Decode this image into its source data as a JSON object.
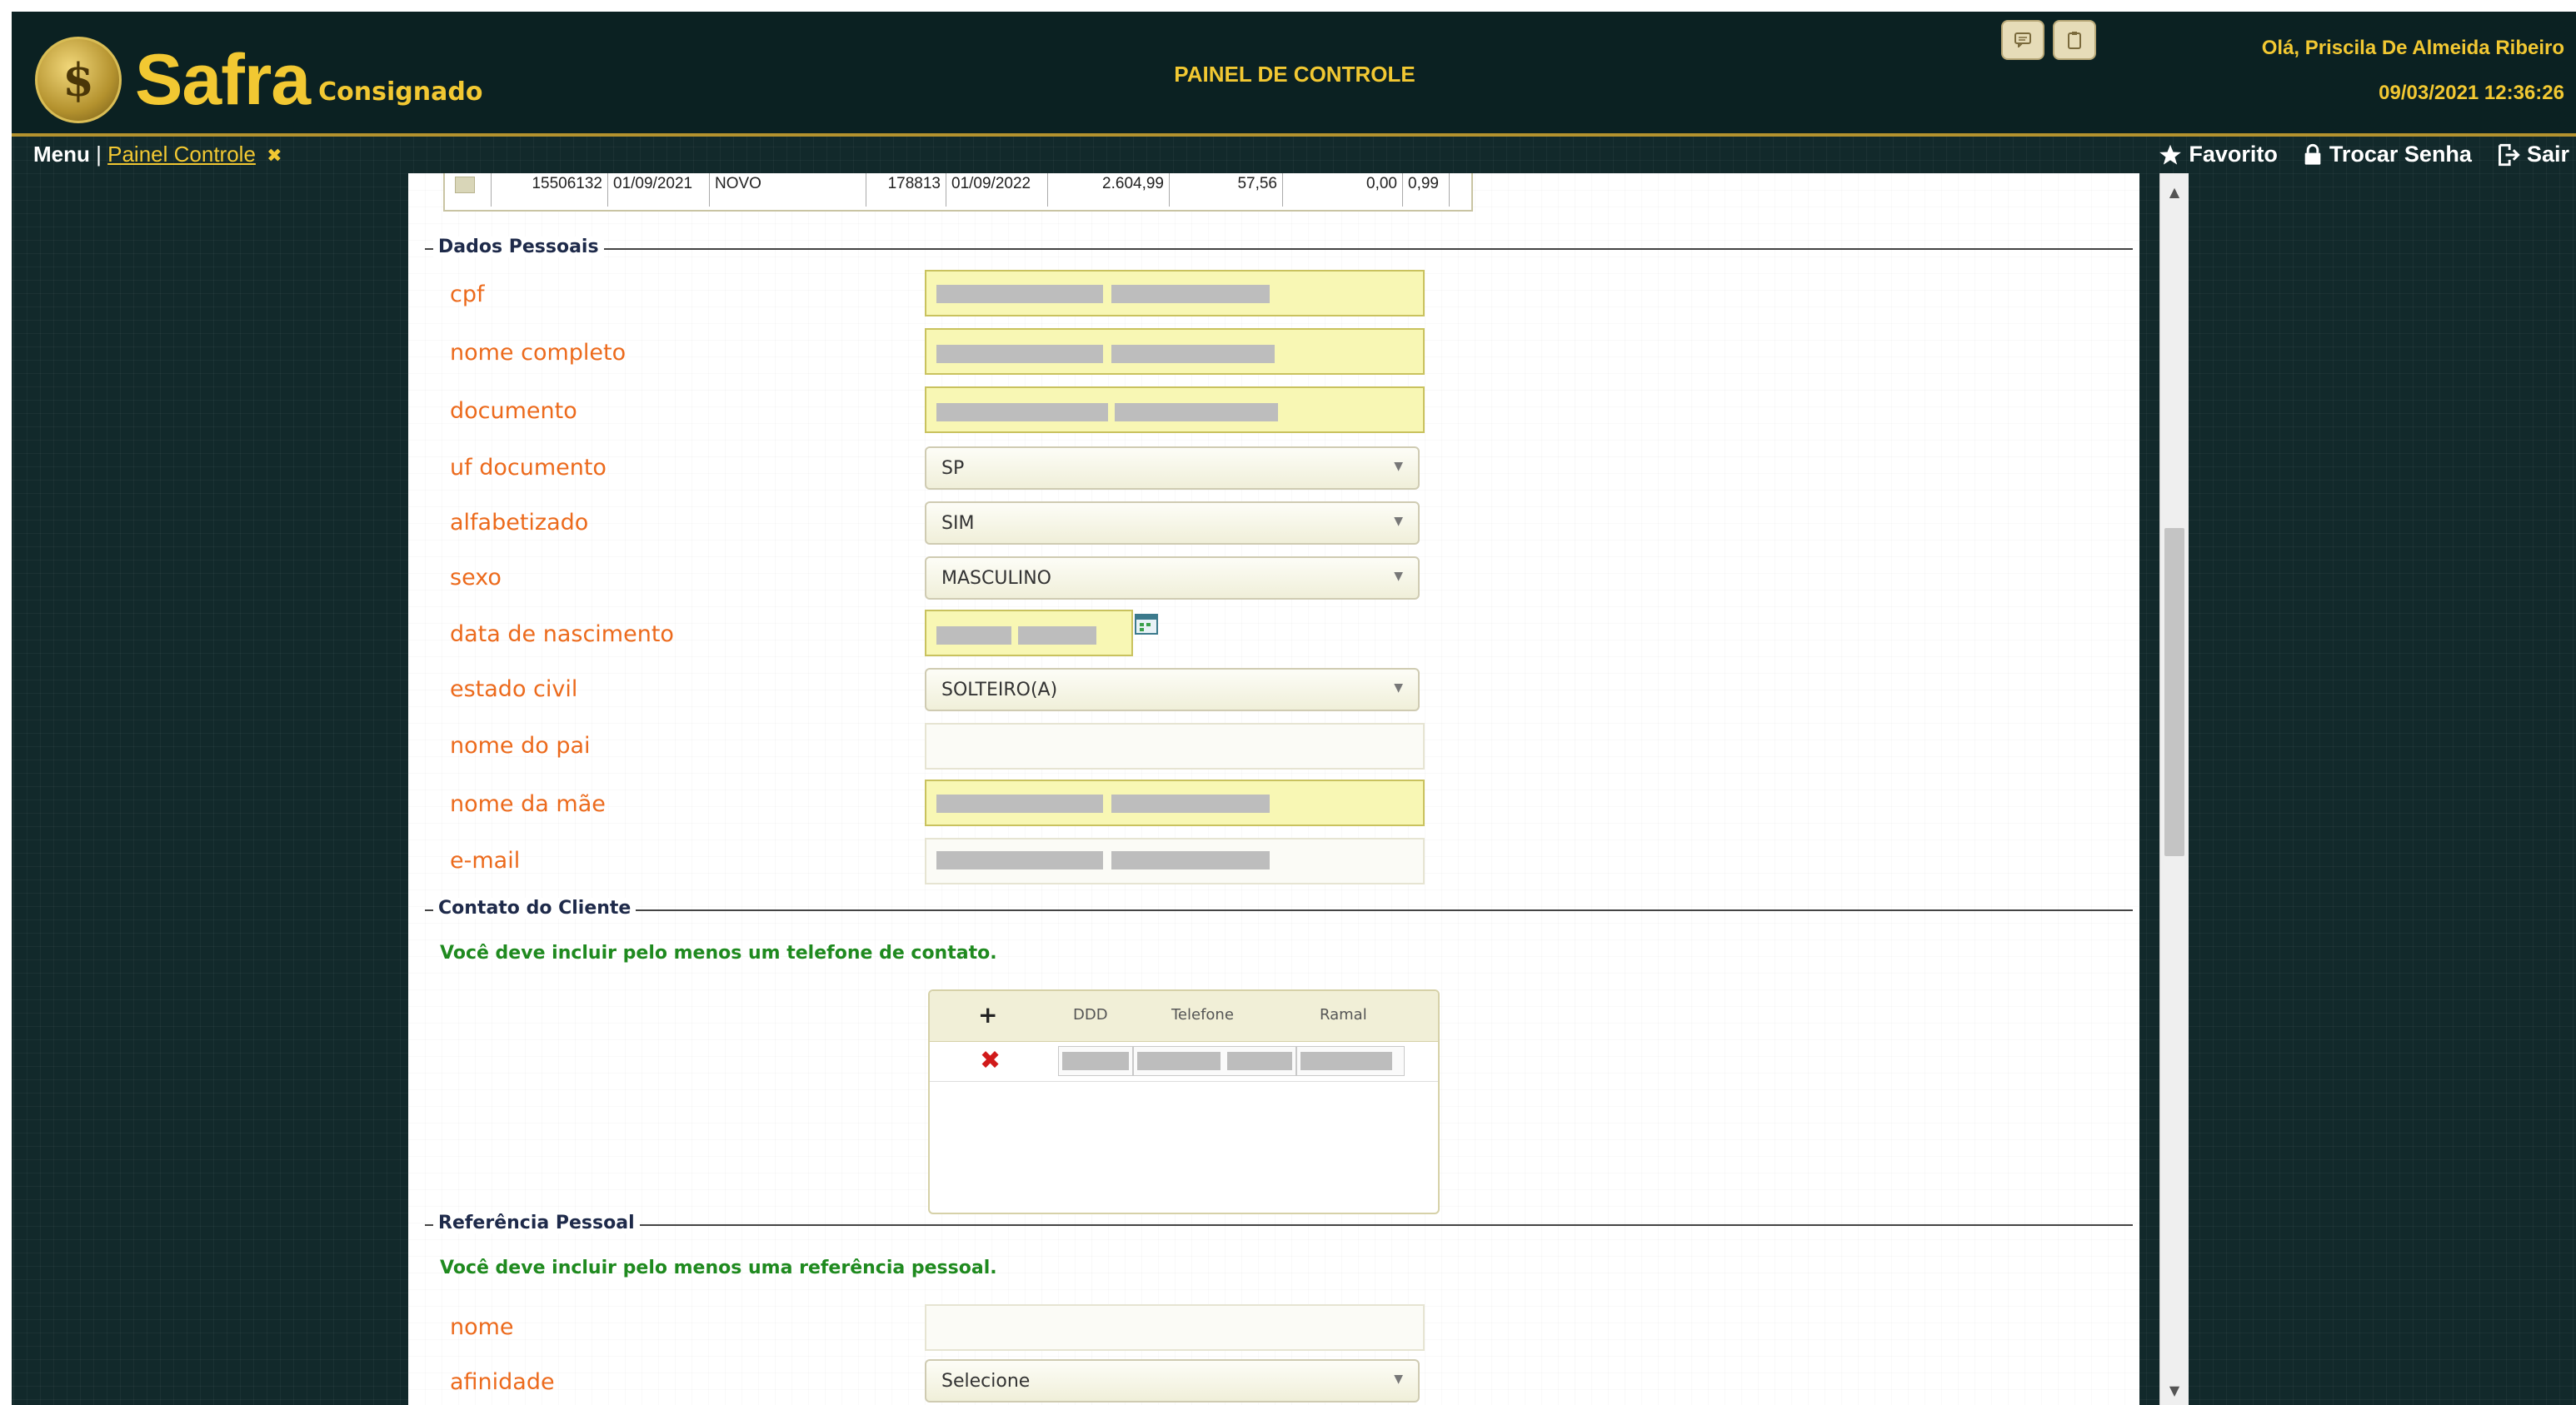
{
  "header": {
    "logo_main": "Safra",
    "logo_sub": "Consignado",
    "title": "PAINEL DE CONTROLE",
    "greeting": "Olá, Priscila De Almeida Ribeiro",
    "datetime": "09/03/2021 12:36:26"
  },
  "menubar": {
    "menu_label": "Menu",
    "separator": "|",
    "crumb": "Painel Controle",
    "crumb_close": "✖",
    "favorito": "Favorito",
    "trocar_senha": "Trocar Senha",
    "sair": "Sair"
  },
  "top_table_row": {
    "c1": "15506132",
    "c2": "01/09/2021",
    "c3": "NOVO",
    "c4": "178813",
    "c5": "01/09/2022",
    "c6": "2.604,99",
    "c7": "57,56",
    "c8": "0,00",
    "c9": "0,99"
  },
  "dados_pessoais": {
    "title": "Dados Pessoais",
    "labels": {
      "cpf": "cpf",
      "nome_completo": "nome completo",
      "documento": "documento",
      "uf_documento": "uf documento",
      "alfabetizado": "alfabetizado",
      "sexo": "sexo",
      "data_nascimento": "data de nascimento",
      "estado_civil": "estado civil",
      "nome_pai": "nome do pai",
      "nome_mae": "nome da mãe",
      "email": "e-mail"
    },
    "values": {
      "uf_documento": "SP",
      "alfabetizado": "SIM",
      "sexo": "MASCULINO",
      "estado_civil": "SOLTEIRO(A)"
    }
  },
  "contato": {
    "title": "Contato do Cliente",
    "warning": "Você deve incluir pelo menos um telefone de contato.",
    "columns": {
      "add": "+",
      "ddd": "DDD",
      "telefone": "Telefone",
      "ramal": "Ramal"
    },
    "remove_icon": "✖"
  },
  "referencia": {
    "title": "Referência Pessoal",
    "warning": "Você deve incluir pelo menos uma referência pessoal.",
    "labels": {
      "nome": "nome",
      "afinidade": "afinidade"
    },
    "values": {
      "afinidade": "Selecione"
    }
  },
  "icons": {
    "calendar": "calendar-icon",
    "star": "star-icon",
    "lock": "lock-icon",
    "exit": "exit-icon"
  },
  "colors": {
    "brand_gold": "#f2c832",
    "label_orange": "#ec6a1c",
    "required_field": "#f8f7b4",
    "warning_green": "#1f8a1f",
    "remove_red": "#d11a1a"
  }
}
